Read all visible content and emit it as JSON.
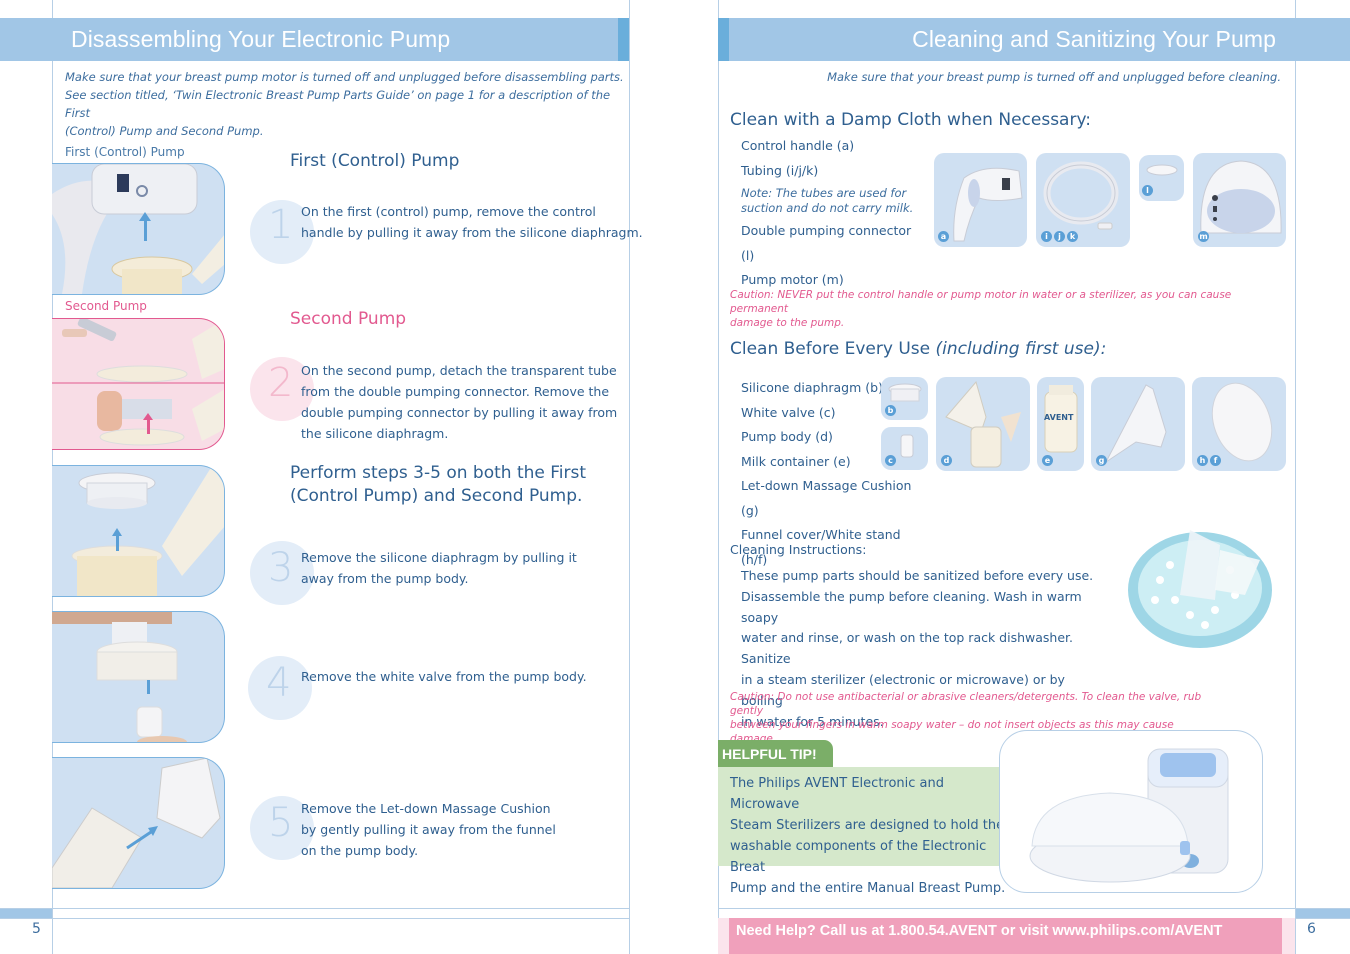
{
  "left_page": {
    "title": "Disassembling Your Electronic Pump",
    "intro": [
      "Make sure that your breast pump motor is turned off and unplugged before disassembling parts.",
      "See section titled, ‘Twin Electronic Breast Pump Parts Guide’ on page 1 for a description of the First",
      "(Control) Pump and Second Pump."
    ],
    "photo_labels": {
      "first": "First (Control) Pump",
      "second": "Second Pump"
    },
    "first_pump_heading": "First (Control) Pump",
    "second_pump_heading": "Second Pump",
    "both_heading": [
      "Perform steps 3-5 on both the First",
      "(Control Pump) and Second Pump."
    ],
    "steps": [
      {
        "number": "1",
        "lines": [
          "On the first (control) pump, remove the control",
          "handle by pulling it away from the silicone diaphragm."
        ]
      },
      {
        "number": "2",
        "lines": [
          "On the second pump, detach the transparent tube",
          "from the double pumping connector. Remove the",
          "double pumping connector by pulling it away from",
          "the silicone diaphragm."
        ]
      },
      {
        "number": "3",
        "lines": [
          "Remove the silicone diaphragm by pulling it",
          "away from the pump body."
        ]
      },
      {
        "number": "4",
        "lines": [
          "Remove the white valve from the pump body."
        ]
      },
      {
        "number": "5",
        "lines": [
          "Remove the Let-down Massage Cushion",
          "by gently pulling it away from the funnel",
          "on the pump body."
        ]
      }
    ],
    "page_number": "5"
  },
  "right_page": {
    "title": "Cleaning and Sanitizing Your Pump",
    "intro": "Make sure that your breast pump is turned off and unplugged before cleaning.",
    "damp_cloth": {
      "heading": "Clean with a Damp Cloth when Necessary:",
      "items": [
        "Control handle (a)",
        "Tubing (i/j/k)"
      ],
      "note": [
        "Note: The tubes are used for",
        "suction and do not carry milk."
      ],
      "items_after_note": [
        "Double pumping connector (l)",
        "Pump motor (m)"
      ],
      "badges": {
        "handle": "a",
        "tubing": [
          "i",
          "j",
          "k"
        ],
        "connector": "l",
        "motor": "m"
      },
      "caution": [
        "Caution: NEVER put the control handle or pump motor in water or a sterilizer, as you can cause permanent",
        "damage to the pump."
      ]
    },
    "every_use": {
      "heading": "Clean Before Every Use ",
      "heading_italic": "(including first use):",
      "items": [
        "Silicone diaphragm (b)",
        "White valve (c)",
        "Pump body (d)",
        "Milk container (e)",
        "Let-down Massage Cushion (g)",
        "Funnel cover/White stand (h/f)"
      ],
      "badges": {
        "diaphragm": "b",
        "valve": "c",
        "body": "d",
        "container": "e",
        "cushion": "g",
        "cover": [
          "h",
          "f"
        ]
      },
      "bottle_brand": "AVENT"
    },
    "instructions": {
      "heading": "Cleaning Instructions:",
      "lines": [
        "These pump parts should be sanitized before every use.",
        "Disassemble the pump before cleaning. Wash in warm soapy",
        "water and rinse, or wash on the top rack dishwasher. Sanitize",
        "in a steam sterilizer (electronic or microwave) or by boiling",
        "in water for 5 minutes."
      ],
      "caution": [
        "Caution: Do not use antibacterial or abrasive cleaners/detergents. To clean the valve, rub gently",
        "between your fingers in warm soapy water – do not insert objects as this may cause damage."
      ]
    },
    "tip": {
      "label": "HELPFUL TIP!",
      "lines": [
        "The Philips AVENT Electronic and Microwave",
        "Steam Sterilizers are designed to hold the",
        "washable components of the Electronic Breat",
        "Pump and the entire Manual Breast Pump."
      ]
    },
    "help_bar": "Need Help? Call us at 1.800.54.AVENT or visit www.philips.com/AVENT",
    "page_number": "6"
  },
  "colors": {
    "banner": "#a1c6e6",
    "banner_accent": "#6aaedb",
    "text_blue": "#2f5f8f",
    "pink": "#e2598f",
    "help_bar": "#f0a0bb",
    "tip_green": "#7bae68",
    "tip_box": "#d5e8cb"
  }
}
